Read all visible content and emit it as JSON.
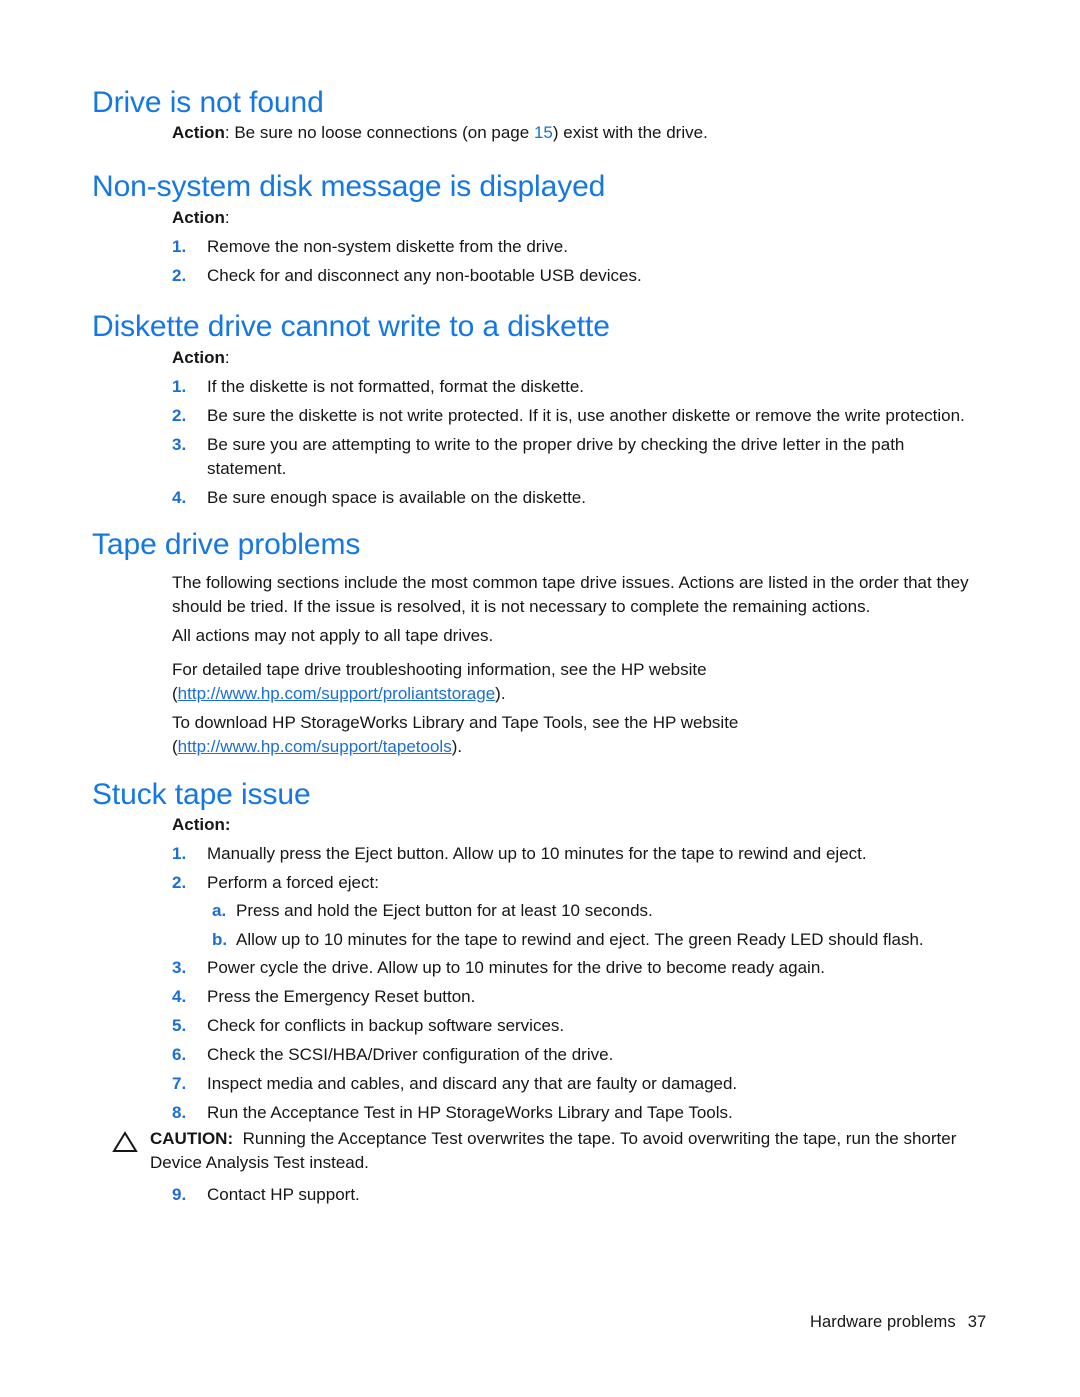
{
  "document": {
    "footer_section": "Hardware problems",
    "footer_page": "37"
  },
  "colors": {
    "heading_blue": "#1477e6",
    "link_blue": "#1a6fd4",
    "body_black": "#161616",
    "page_background": "#ffffff"
  },
  "sections": {
    "drive_not_found": {
      "heading": "Drive is not found",
      "action_label": "Action",
      "action_sep": ": ",
      "action_text_before": "Be sure no loose connections (on page ",
      "action_xref": "15",
      "action_text_after": ") exist with the drive."
    },
    "non_system_disk": {
      "heading": "Non-system disk message is displayed",
      "action_label": "Action",
      "action_sep": ":",
      "items": [
        {
          "marker": "1.",
          "text": "Remove the non-system diskette from the drive."
        },
        {
          "marker": "2.",
          "text": "Check for and disconnect any non-bootable USB devices."
        }
      ]
    },
    "diskette_cannot_write": {
      "heading": "Diskette drive cannot write to a diskette",
      "action_label": "Action",
      "action_sep": ":",
      "items": [
        {
          "marker": "1.",
          "text": "If the diskette is not formatted, format the diskette."
        },
        {
          "marker": "2.",
          "text": "Be sure the diskette is not write protected. If it is, use another diskette or remove the write protection."
        },
        {
          "marker": "3.",
          "text": "Be sure you are attempting to write to the proper drive by checking the drive letter in the path statement."
        },
        {
          "marker": "4.",
          "text": "Be sure enough space is available on the diskette."
        }
      ]
    },
    "tape_drive_problems": {
      "heading": "Tape drive problems",
      "paragraph_1": "The following sections include the most common tape drive issues. Actions are listed in the order that they should be tried. If the issue is resolved, it is not necessary to complete the remaining actions.",
      "paragraph_2": "All actions may not apply to all tape drives.",
      "paragraph_3_lead": "For detailed tape drive troubleshooting information, see the HP website",
      "paragraph_3_open": "(",
      "paragraph_3_url": "http://www.hp.com/support/proliantstorage",
      "paragraph_3_close": ").",
      "paragraph_4_lead": "To download HP StorageWorks Library and Tape Tools, see the HP website",
      "paragraph_4_open": "(",
      "paragraph_4_url": "http://www.hp.com/support/tapetools",
      "paragraph_4_close": ")."
    },
    "stuck_tape_issue": {
      "heading": "Stuck tape issue",
      "action_label": "Action:",
      "items_top": [
        {
          "marker": "1.",
          "text": "Manually press the Eject button. Allow up to 10 minutes for the tape to rewind and eject."
        },
        {
          "marker": "2.",
          "text": "Perform a forced eject:"
        }
      ],
      "sub_items": [
        {
          "marker": "a.",
          "text": "Press and hold the Eject button for at least 10 seconds."
        },
        {
          "marker": "b.",
          "text": "Allow up to 10 minutes for the tape to rewind and eject. The green Ready LED should flash."
        }
      ],
      "items_mid": [
        {
          "marker": "3.",
          "text": "Power cycle the drive. Allow up to 10 minutes for the drive to become ready again."
        },
        {
          "marker": "4.",
          "text": "Press the Emergency Reset button."
        },
        {
          "marker": "5.",
          "text": "Check for conflicts in backup software services."
        },
        {
          "marker": "6.",
          "text": "Check the SCSI/HBA/Driver configuration of the drive."
        },
        {
          "marker": "7.",
          "text": "Inspect media and cables, and discard any that are faulty or damaged."
        },
        {
          "marker": "8.",
          "text": "Run the Acceptance Test in HP StorageWorks Library and Tape Tools."
        }
      ],
      "caution": {
        "label": "CAUTION:",
        "text": "Running the Acceptance Test overwrites the tape. To avoid overwriting the tape, run the shorter Device Analysis Test instead."
      },
      "items_end": [
        {
          "marker": "9.",
          "text": "Contact HP support."
        }
      ]
    }
  }
}
